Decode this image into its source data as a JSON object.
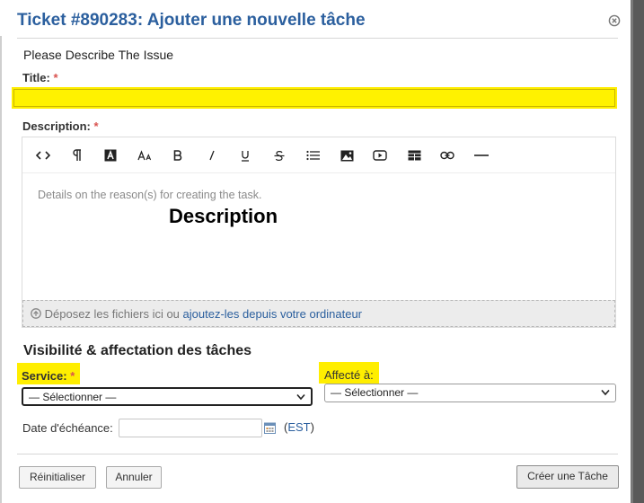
{
  "dialog": {
    "title": "Ticket #890283: Ajouter une nouvelle tâche",
    "instructions": "Please Describe The Issue"
  },
  "form": {
    "title_label": "Title:",
    "title_required": "*",
    "title_value": "",
    "description_label": "Description:",
    "description_required": "*",
    "description_placeholder": "Details on the reason(s) for creating the task.",
    "description_overlay": "Description",
    "toolbar": [
      {
        "name": "code-view-icon"
      },
      {
        "name": "paragraph-icon"
      },
      {
        "name": "text-color-icon"
      },
      {
        "name": "font-size-icon"
      },
      {
        "name": "bold-icon"
      },
      {
        "name": "italic-icon"
      },
      {
        "name": "underline-icon"
      },
      {
        "name": "strikethrough-icon"
      },
      {
        "name": "unordered-list-icon"
      },
      {
        "name": "image-icon"
      },
      {
        "name": "video-icon"
      },
      {
        "name": "table-icon"
      },
      {
        "name": "link-icon"
      },
      {
        "name": "horizontal-rule-icon"
      }
    ],
    "dropzone_text": "Déposez les fichiers ici ou",
    "dropzone_link": "ajoutez-les depuis votre ordinateur"
  },
  "visibility": {
    "section_title": "Visibilité & affectation des tâches",
    "service_label": "Service:",
    "service_required": "*",
    "service_value": "— Sélectionner —",
    "assigned_label": "Affecté à:",
    "assigned_value": "— Sélectionner —",
    "due_date_label": "Date d'échéance:",
    "due_date_value": "",
    "timezone_open": "(",
    "timezone": "EST",
    "timezone_close": ")"
  },
  "footer": {
    "reset_label": "Réinitialiser",
    "cancel_label": "Annuler",
    "create_label": "Créer une Tâche"
  },
  "colors": {
    "accent": "#2b5f9e",
    "highlight": "#ffee00",
    "required": "#d9534f"
  }
}
